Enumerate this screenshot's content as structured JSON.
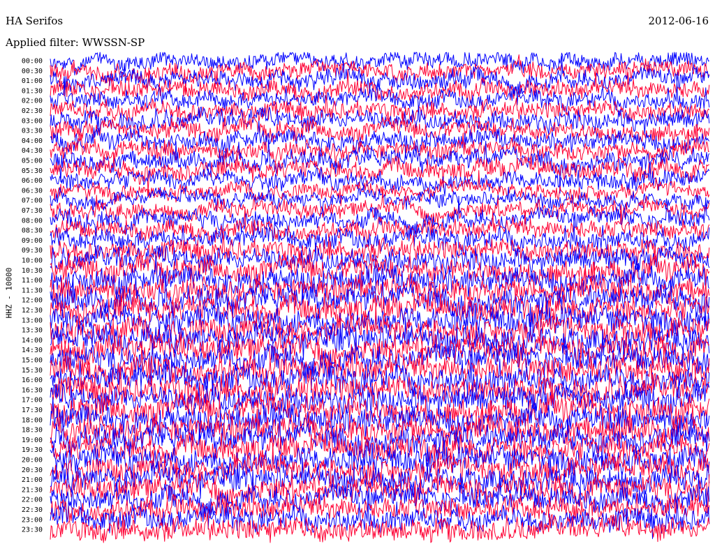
{
  "header": {
    "station": "HA Serifos",
    "date": "2012-06-16",
    "filter": "Applied filter: WWSSN-SP"
  },
  "chart_data": {
    "type": "line",
    "channel_label": "HHZ - 10000",
    "row_labels": [
      "00:00",
      "00:30",
      "01:00",
      "01:30",
      "02:00",
      "02:30",
      "03:00",
      "03:30",
      "04:00",
      "04:30",
      "05:00",
      "05:30",
      "06:00",
      "06:30",
      "07:00",
      "07:30",
      "08:00",
      "08:30",
      "09:00",
      "09:30",
      "10:00",
      "10:30",
      "11:00",
      "11:30",
      "12:00",
      "12:30",
      "13:00",
      "13:30",
      "14:00",
      "14:30",
      "15:00",
      "15:30",
      "16:00",
      "16:30",
      "17:00",
      "17:30",
      "18:00",
      "18:30",
      "19:00",
      "19:30",
      "20:00",
      "20:30",
      "21:00",
      "21:30",
      "22:00",
      "22:30",
      "23:00",
      "23:30"
    ],
    "trace_colors": [
      "#0000ff",
      "#ff0033"
    ],
    "minutes_per_row": 30,
    "amplitude_profile": [
      0.55,
      0.6,
      0.62,
      0.6,
      0.58,
      0.6,
      0.65,
      0.62,
      0.6,
      0.62,
      0.64,
      0.66,
      0.58,
      0.5,
      0.48,
      0.55,
      0.6,
      0.62,
      0.66,
      0.7,
      0.78,
      0.82,
      0.85,
      0.86,
      0.88,
      0.9,
      0.9,
      0.9,
      0.9,
      0.9,
      0.9,
      0.92,
      0.92,
      0.92,
      0.92,
      0.92,
      0.92,
      0.92,
      0.9,
      0.9,
      0.9,
      0.88,
      0.86,
      0.85,
      0.82,
      0.8,
      0.78,
      0.78
    ]
  }
}
